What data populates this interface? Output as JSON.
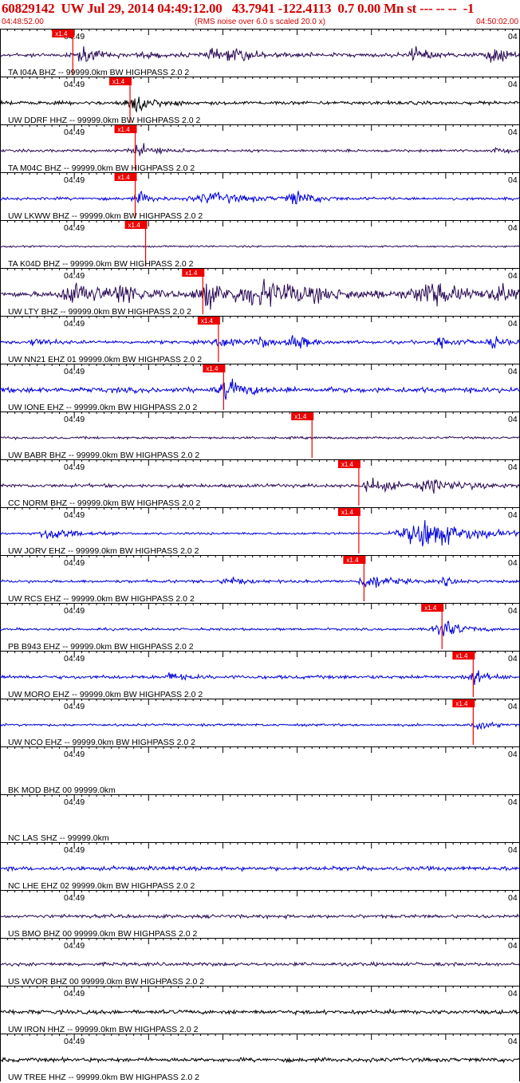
{
  "header": {
    "title": "60829142  UW Jul 29, 2014 04:49:12.00   43.7941 -122.4113  0.7 0.00 Mn st --- -- --  -1",
    "start_time": "04:48:52.00",
    "end_time": "04:50:02.00",
    "subtitle": "(RMS noise over 6.0 s scaled 20.0 x)"
  },
  "colors": {
    "title": "#d40000",
    "purple": "#2a0a55",
    "blue": "#0000dd",
    "black": "#000000",
    "pick": "#ee0000"
  },
  "chart_data": {
    "type": "line",
    "title": "60829142  UW Jul 29, 2014 04:49:12.00   43.7941 -122.4113  0.7 0.00 Mn st --- -- --  -1",
    "subtitle": "(RMS noise over 6.0 s scaled 20.0 x)",
    "x_range": [
      "04:48:52.00",
      "04:50:02.00"
    ],
    "tick_labels": [
      "04:49",
      "04"
    ],
    "pick_label": "x1.4",
    "series": [
      {
        "name": "TA I04A BHZ -- 99999.0km BW  HIGHPASS  2.0  2",
        "color": "purple",
        "pick": 0.14,
        "amp": 10,
        "noise": 0.35,
        "bursts": [
          [
            0.16,
            0.02,
            1.3
          ],
          [
            0.42,
            0.05,
            0.7
          ],
          [
            0.46,
            0.03,
            0.5
          ],
          [
            0.8,
            0.02,
            1.3
          ],
          [
            0.95,
            0.02,
            1.6
          ],
          [
            0.28,
            0.02,
            0.4
          ]
        ]
      },
      {
        "name": "UW DDRF HHZ -- 99999.0km BW  HIGHPASS  2.0  2",
        "color": "black",
        "pick": 0.25,
        "amp": 10,
        "noise": 0.3,
        "bursts": [
          [
            0.26,
            0.03,
            1.5
          ]
        ]
      },
      {
        "name": "TA M04C BHZ -- 99999.0km BW  HIGHPASS  2.0  2",
        "color": "purple",
        "pick": 0.26,
        "amp": 10,
        "noise": 0.22,
        "bursts": [
          [
            0.27,
            0.03,
            1.1
          ],
          [
            0.95,
            0.02,
            0.4
          ]
        ]
      },
      {
        "name": "UW LKWW BHZ -- 99999.0km BW  HIGHPASS  2.0  2",
        "color": "blue",
        "pick": 0.26,
        "amp": 10,
        "noise": 0.25,
        "bursts": [
          [
            0.27,
            0.02,
            1.0
          ],
          [
            0.41,
            0.06,
            0.9
          ],
          [
            0.57,
            0.03,
            1.2
          ]
        ]
      },
      {
        "name": "TA K04D BHZ -- 99999.0km BW  HIGHPASS  2.0  2",
        "color": "purple",
        "pick": 0.28,
        "amp": 10,
        "noise": 0.15,
        "bursts": []
      },
      {
        "name": "UW LTY BHZ -- 99999.0km BW  HIGHPASS  2.0  2",
        "color": "purple",
        "pick": 0.39,
        "amp": 10,
        "noise": 0.45,
        "bursts": [
          [
            0.15,
            0.05,
            2.0
          ],
          [
            0.24,
            0.03,
            1.5
          ],
          [
            0.4,
            0.04,
            2.0
          ],
          [
            0.52,
            0.1,
            2.0
          ],
          [
            0.83,
            0.06,
            1.8
          ],
          [
            0.96,
            0.03,
            1.5
          ]
        ]
      },
      {
        "name": "UW NN21 EHZ 01 99999.0km BW  HIGHPASS  2.0  2",
        "color": "blue",
        "pick": 0.42,
        "amp": 10,
        "noise": 0.28,
        "bursts": [
          [
            0.43,
            0.02,
            1.3
          ],
          [
            0.5,
            0.02,
            1.1
          ],
          [
            0.57,
            0.02,
            1.4
          ],
          [
            0.07,
            0.02,
            0.7
          ],
          [
            0.85,
            0.02,
            1.2
          ],
          [
            0.95,
            0.02,
            1.0
          ]
        ]
      },
      {
        "name": "UW IONE EHZ -- 99999.0km BW  HIGHPASS  2.0  2",
        "color": "blue",
        "pick": 0.43,
        "amp": 10,
        "noise": 0.45,
        "bursts": [
          [
            0.44,
            0.03,
            1.5
          ]
        ]
      },
      {
        "name": "UW BABR BHZ -- 99999.0km BW  HIGHPASS  2.0  2",
        "color": "purple",
        "pick": 0.6,
        "amp": 10,
        "noise": 0.2,
        "bursts": []
      },
      {
        "name": "CC NORM BHZ -- 99999.0km BW  HIGHPASS  2.0  2",
        "color": "purple",
        "pick": 0.69,
        "amp": 10,
        "noise": 0.3,
        "bursts": [
          [
            0.72,
            0.04,
            1.0
          ],
          [
            0.84,
            0.06,
            0.9
          ]
        ]
      },
      {
        "name": "UW JORV EHZ -- 99999.0km BW  HIGHPASS  2.0  2",
        "color": "blue",
        "pick": 0.69,
        "amp": 10,
        "noise": 0.2,
        "bursts": [
          [
            0.1,
            0.03,
            1.4
          ],
          [
            0.82,
            0.07,
            2.6
          ]
        ]
      },
      {
        "name": "UW RCS EHZ -- 99999.0km BW  HIGHPASS  2.0  2",
        "color": "blue",
        "pick": 0.7,
        "amp": 10,
        "noise": 0.25,
        "bursts": [
          [
            0.71,
            0.03,
            1.5
          ],
          [
            0.44,
            0.02,
            0.8
          ],
          [
            0.86,
            0.02,
            0.6
          ]
        ]
      },
      {
        "name": "PB B943 EHZ -- 99999.0km BW  HIGHPASS  2.0  2",
        "color": "blue",
        "pick": 0.85,
        "amp": 10,
        "noise": 0.2,
        "bursts": [
          [
            0.85,
            0.03,
            1.9
          ]
        ]
      },
      {
        "name": "UW MORO EHZ -- 99999.0km BW  HIGHPASS  2.0  2",
        "color": "blue",
        "pick": 0.91,
        "amp": 10,
        "noise": 0.3,
        "bursts": [
          [
            0.91,
            0.02,
            1.3
          ],
          [
            0.33,
            0.02,
            0.6
          ]
        ]
      },
      {
        "name": "UW NCO EHZ -- 99999.0km BW  HIGHPASS  2.0  2",
        "color": "blue",
        "pick": 0.91,
        "amp": 10,
        "noise": 0.2,
        "bursts": [
          [
            0.92,
            0.02,
            0.8
          ]
        ]
      },
      {
        "name": "BK MOD BHZ 00 99999.0km",
        "color": "blue",
        "pick": null,
        "amp": 0,
        "noise": 0,
        "bursts": []
      },
      {
        "name": "NC LAS SHZ -- 99999.0km",
        "color": "blue",
        "pick": null,
        "amp": 0,
        "noise": 0,
        "bursts": []
      },
      {
        "name": "NC LHE EHZ 02 99999.0km BW  HIGHPASS  2.0  2",
        "color": "blue",
        "pick": null,
        "amp": 10,
        "noise": 0.35,
        "bursts": []
      },
      {
        "name": "US BMO BHZ 00 99999.0km BW  HIGHPASS  2.0  2",
        "color": "purple",
        "pick": null,
        "amp": 10,
        "noise": 0.3,
        "bursts": []
      },
      {
        "name": "US WVOR BHZ 00 99999.0km BW  HIGHPASS  2.0  2",
        "color": "purple",
        "pick": null,
        "amp": 10,
        "noise": 0.3,
        "bursts": []
      },
      {
        "name": "UW IRON HHZ -- 99999.0km BW  HIGHPASS  2.0  2",
        "color": "black",
        "pick": null,
        "amp": 10,
        "noise": 0.35,
        "bursts": []
      },
      {
        "name": "UW TREE HHZ -- 99999.0km BW  HIGHPASS  2.0  2",
        "color": "black",
        "pick": null,
        "amp": 10,
        "noise": 0.35,
        "bursts": []
      }
    ]
  }
}
